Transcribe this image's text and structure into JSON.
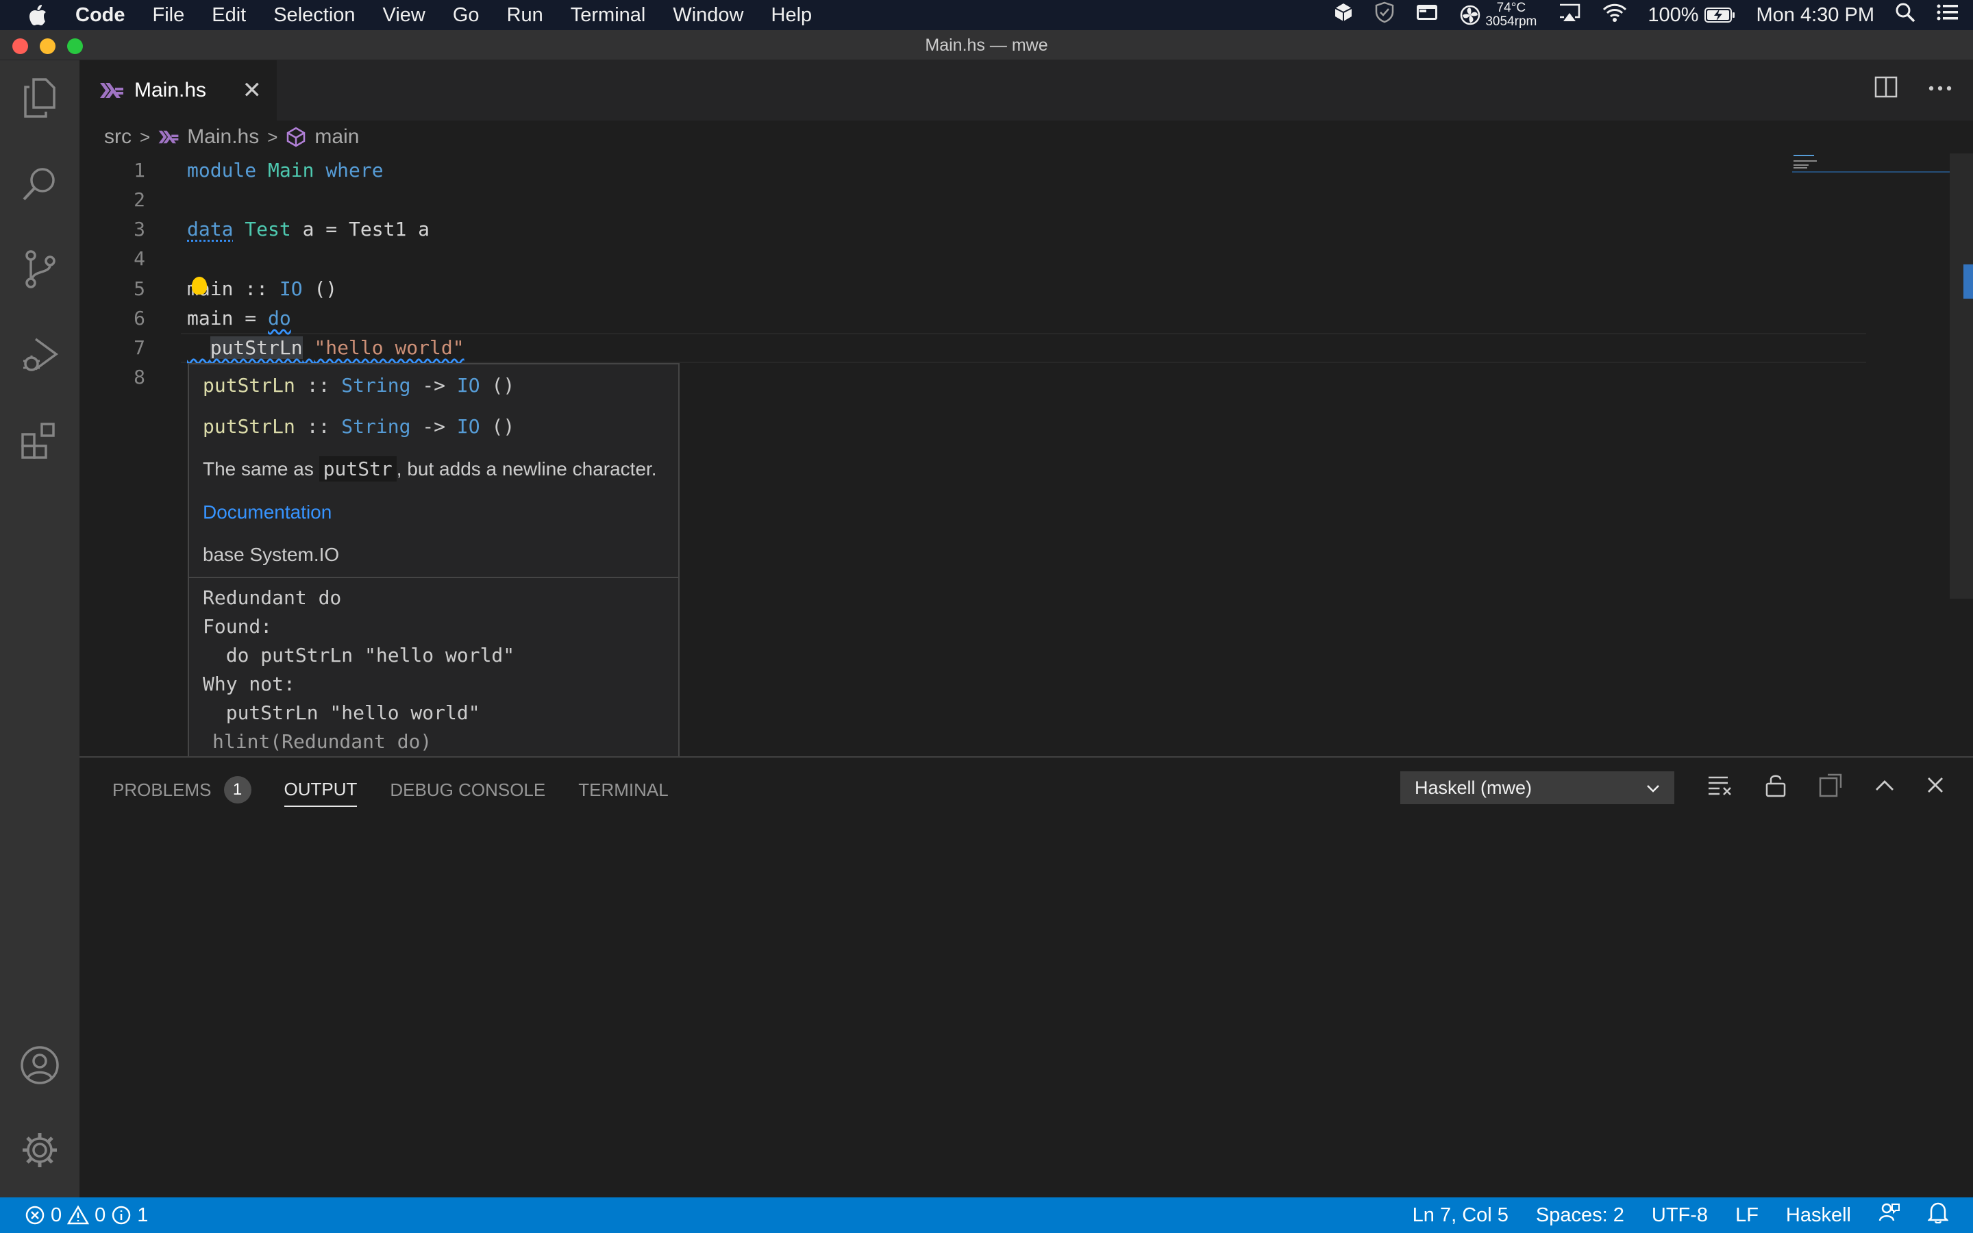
{
  "menubar": {
    "app": "Code",
    "items": [
      "File",
      "Edit",
      "Selection",
      "View",
      "Go",
      "Run",
      "Terminal",
      "Window",
      "Help"
    ],
    "temp": "74°C",
    "rpm": "3054rpm",
    "battery": "100%",
    "clock": "Mon 4:30 PM"
  },
  "window": {
    "title": "Main.hs — mwe"
  },
  "tab": {
    "label": "Main.hs"
  },
  "breadcrumb": {
    "folder": "src",
    "file": "Main.hs",
    "symbol": "main"
  },
  "editor": {
    "line_numbers": [
      "1",
      "2",
      "3",
      "4",
      "5",
      "6",
      "7",
      "8"
    ],
    "lines": {
      "l1_kw1": "module",
      "l1_ty": "Main",
      "l1_kw2": "where",
      "l3_kw": "data",
      "l3_ty": "Test",
      "l3_rest": "a = Test1 a",
      "l5_name": "main",
      "l5_sep": "::",
      "l5_ty": "IO",
      "l5_unit": "()",
      "l6_name": "main",
      "l6_eq": "=",
      "l6_kw": "do",
      "l7_fn": "putStrLn",
      "l7_str": "\"hello world\""
    }
  },
  "hover": {
    "sig1_fn": "putStrLn",
    "sig1_rest_a": "::",
    "sig1_ty1": "String",
    "sig1_arrow": "->",
    "sig1_ty2": "IO",
    "sig1_unit": "()",
    "desc_a": "The same as",
    "desc_code": "putStr",
    "desc_b": ", but adds a newline character.",
    "doc_link": "Documentation",
    "module": "base System.IO",
    "hint_title": "Redundant do",
    "hint_found": "Found:",
    "hint_found_code": "  do putStrLn \"hello world\"",
    "hint_why": "Why not:",
    "hint_why_code": "  putStrLn \"hello world\"",
    "hint_source": "hlint(Redundant do)"
  },
  "panel": {
    "tabs": {
      "problems": "PROBLEMS",
      "problems_count": "1",
      "output": "OUTPUT",
      "debug": "DEBUG CONSOLE",
      "terminal": "TERMINAL"
    },
    "output_channel": "Haskell (mwe)"
  },
  "statusbar": {
    "errors": "0",
    "warnings": "0",
    "infos": "1",
    "position": "Ln 7, Col 5",
    "spaces": "Spaces: 2",
    "encoding": "UTF-8",
    "eol": "LF",
    "language": "Haskell"
  },
  "colors": {
    "accent": "#007acc",
    "keyword": "#569cd6",
    "type": "#4ec9b0",
    "string": "#ce9178",
    "function": "#dcdcaa",
    "haskell_icon": "#a074c4"
  }
}
